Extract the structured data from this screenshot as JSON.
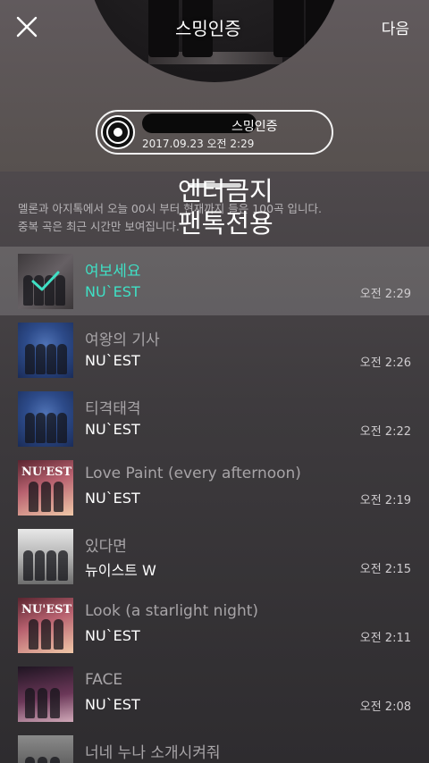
{
  "header": {
    "overlay_text": "스밍인증",
    "next_label": "다음",
    "badge": {
      "title": "스밍인증",
      "datetime": "2017.09.23 오전 2:29"
    }
  },
  "notice": {
    "line1": "멜론과 아지톡에서 오늘 00시 부터 현재까지 들은 100곡 입니다.",
    "line2": "중복 곡은 최근 시간만 보여집니다."
  },
  "watermark": {
    "line1": "엔터금지",
    "line2": "팬톡전용"
  },
  "songs": [
    {
      "title": "여보세요",
      "artist": "NU`EST",
      "time": "오전 2:29"
    },
    {
      "title": "여왕의 기사",
      "artist": "NU`EST",
      "time": "오전 2:26"
    },
    {
      "title": "티격태격",
      "artist": "NU`EST",
      "time": "오전 2:22"
    },
    {
      "title": "Love Paint (every afternoon)",
      "artist": "NU`EST",
      "time": "오전 2:19"
    },
    {
      "title": "있다면",
      "artist": "뉴이스트 W",
      "time": "오전 2:15"
    },
    {
      "title": "Look (a starlight night)",
      "artist": "NU`EST",
      "time": "오전 2:11"
    },
    {
      "title": "FACE",
      "artist": "NU`EST",
      "time": "오전 2:08"
    },
    {
      "title": "너네 누나 소개시켜줘",
      "artist": "",
      "time": ""
    }
  ],
  "album_logo": "NU'EST",
  "colors": {
    "accent": "#3fe0c5",
    "background": "#3d3a3d"
  },
  "icons": {
    "close": "close-icon",
    "disc": "disc-icon",
    "check": "check-icon"
  }
}
